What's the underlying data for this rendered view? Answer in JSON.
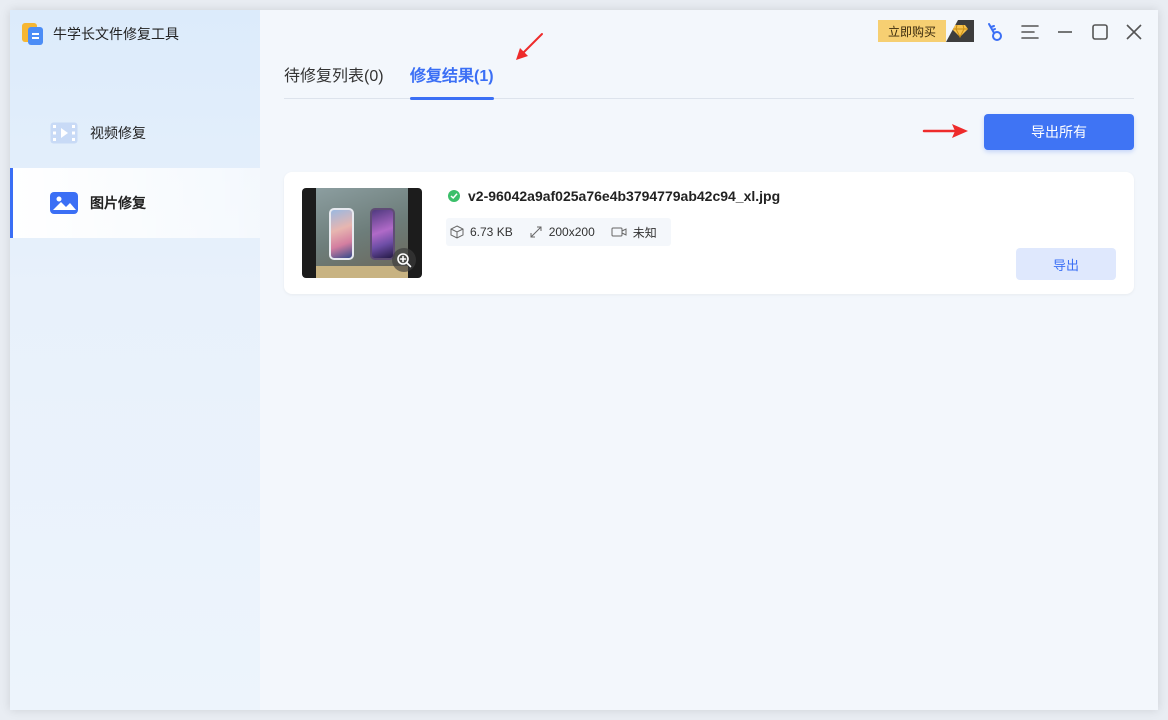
{
  "app": {
    "title": "牛学长文件修复工具"
  },
  "sidebar": {
    "items": [
      {
        "label": "视频修复",
        "icon": "video-icon",
        "active": false
      },
      {
        "label": "图片修复",
        "icon": "image-icon",
        "active": true
      }
    ]
  },
  "topbar": {
    "buy_label": "立即购买",
    "icons": [
      "diamond-icon",
      "key-icon",
      "menu-icon",
      "minimize-icon",
      "maximize-icon",
      "close-icon"
    ]
  },
  "tabs": [
    {
      "label": "待修复列表(0)",
      "active": false
    },
    {
      "label": "修复结果(1)",
      "active": true
    }
  ],
  "actions": {
    "export_all_label": "导出所有"
  },
  "results": [
    {
      "filename": "v2-96042a9af025a76e4b3794779ab42c94_xl.jpg",
      "status": "success",
      "size": "6.73 KB",
      "dimensions": "200x200",
      "duration": "未知",
      "export_label": "导出"
    }
  ],
  "colors": {
    "accent": "#3b6ff5",
    "success": "#3bbf6a",
    "buy": "#f6cf72",
    "annotation": "#ee2b2b"
  }
}
